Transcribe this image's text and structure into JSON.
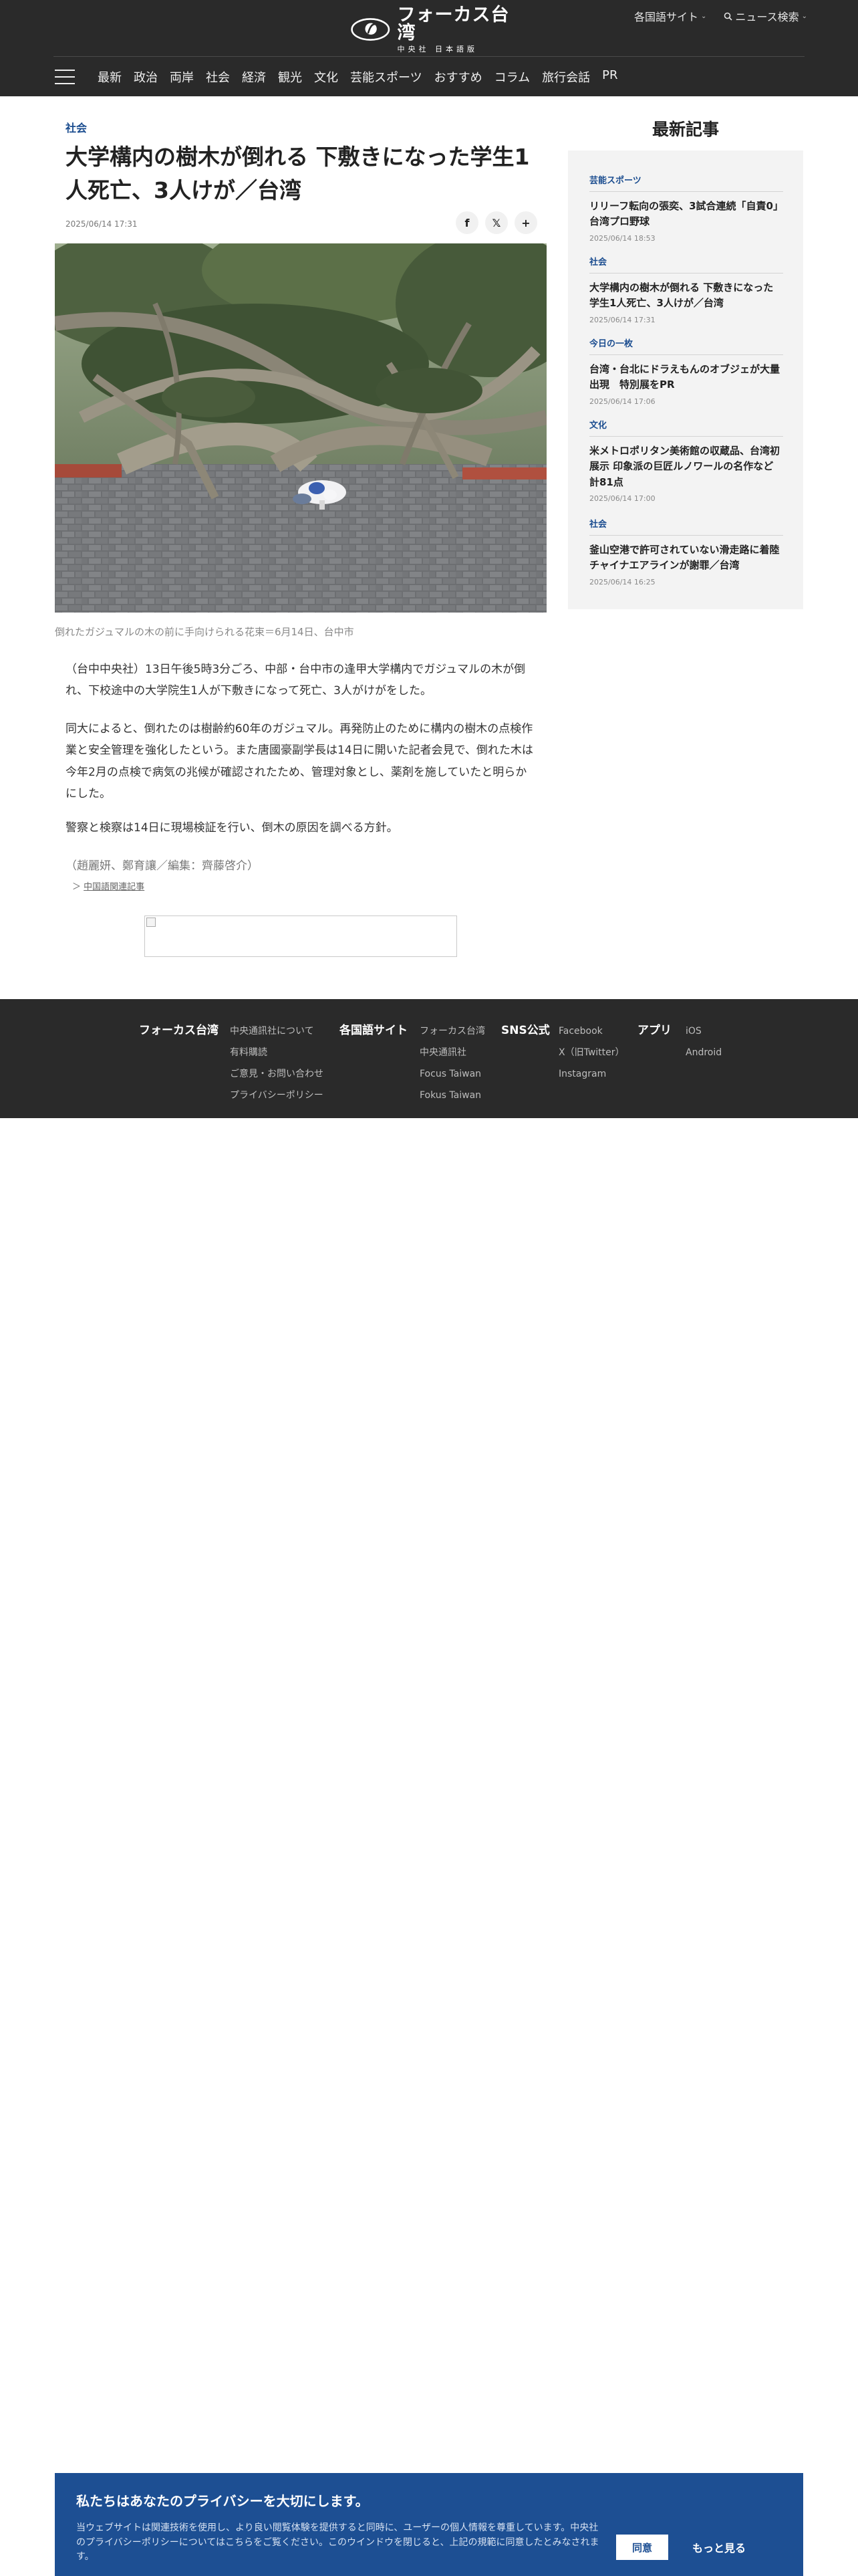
{
  "header": {
    "logo_main": "フォーカス台湾",
    "logo_sub": "中央社 日本語版",
    "lang_sites": "各国語サイト",
    "news_search": "ニュース検索"
  },
  "nav": {
    "items": [
      "最新",
      "政治",
      "両岸",
      "社会",
      "経済",
      "観光",
      "文化",
      "芸能スポーツ",
      "おすすめ",
      "コラム",
      "旅行会話",
      "PR"
    ]
  },
  "article": {
    "category": "社会",
    "title": "大学構内の樹木が倒れる 下敷きになった学生1人死亡、3人けが／台湾",
    "date": "2025/06/14 17:31",
    "share": [
      "f",
      "𝕏",
      "+"
    ],
    "image_caption": "倒れたガジュマルの木の前に手向けられる花束＝6月14日、台中市",
    "paragraphs": [
      "（台中中央社）13日午後5時3分ごろ、中部・台中市の逢甲大学構内でガジュマルの木が倒れ、下校途中の大学院生1人が下敷きになって死亡、3人がけがをした。",
      "同大によると、倒れたのは樹齢約60年のガジュマル。再発防止のために構内の樹木の点検作業と安全管理を強化したという。また唐國豪副学長は14日に開いた記者会見で、倒れた木は今年2月の点検で病気の兆候が確認されたため、管理対象とし、薬剤を施していたと明らかにした。",
      "警察と検察は14日に現場検証を行い、倒木の原因を調べる方針。"
    ],
    "byline": "（趙麗妍、鄭育讓／編集：齊藤啓介）",
    "related_prefix": "＞",
    "related_link": "中国語関連記事"
  },
  "sidebar": {
    "heading": "最新記事",
    "items": [
      {
        "category": "芸能スポーツ",
        "title": "リリーフ転向の張奕、3試合連続「自責0」 台湾プロ野球",
        "date": "2025/06/14 18:53"
      },
      {
        "category": "社会",
        "title": "大学構内の樹木が倒れる 下敷きになった学生1人死亡、3人けが／台湾",
        "date": "2025/06/14 17:31"
      },
      {
        "category": "今日の一枚",
        "title": "台湾・台北にドラえもんのオブジェが大量出現　特別展をPR",
        "date": "2025/06/14 17:06"
      },
      {
        "category": "文化",
        "title": "米メトロポリタン美術館の収蔵品、台湾初展示 印象派の巨匠ルノワールの名作など計81点",
        "date": "2025/06/14 17:00"
      },
      {
        "category": "社会",
        "title": "釜山空港で許可されていない滑走路に着陸 チャイナエアラインが謝罪／台湾",
        "date": "2025/06/14 16:25"
      }
    ]
  },
  "footer": {
    "col1_head": "フォーカス台湾",
    "col1_links": [
      "中央通訊社について",
      "有料購読",
      "ご意見・お問い合わせ",
      "プライバシーポリシー"
    ],
    "col2_head": "各国語サイト",
    "col2_links": [
      "フォーカス台湾",
      "中央通訊社",
      "Focus Taiwan",
      "Fokus Taiwan"
    ],
    "col3_head": "SNS公式",
    "col3_links": [
      "Facebook",
      "X（旧Twitter）",
      "Instagram"
    ],
    "col4_head": "アプリ",
    "col4_links": [
      "iOS",
      "Android"
    ]
  },
  "cookie": {
    "title": "私たちはあなたのプライバシーを大切にします。",
    "text": "当ウェブサイトは関連技術を使用し、より良い閲覧体験を提供すると同時に、ユーザーの個人情報を尊重しています。中央社のプライバシーポリシーについてはこちらをご覧ください。このウインドウを閉じると、上記の規範に同意したとみなされます。",
    "agree": "同意",
    "more": "もっと見る"
  },
  "colors": {
    "header_bg": "#2a2a2a",
    "accent_blue": "#1a4c8f",
    "cookie_bg": "#1d4f93",
    "sidebar_bg": "#f3f3f3"
  }
}
